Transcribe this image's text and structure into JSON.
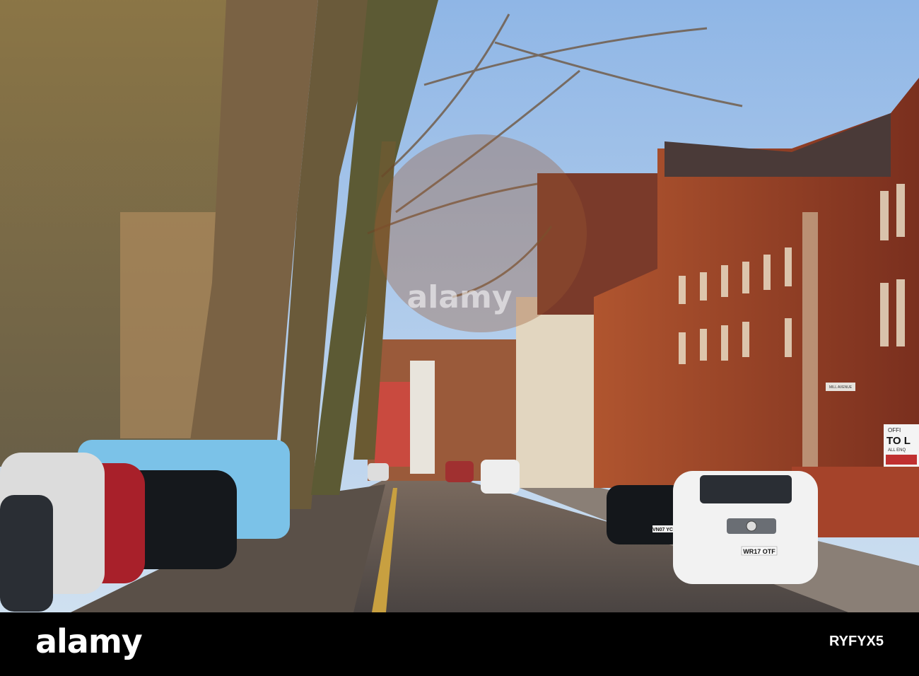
{
  "photo": {
    "description_colors": {
      "sky": "#a9c8ea",
      "brick": "#8e3a22",
      "cobble": "#5b5450",
      "shadow": "#2a2220"
    },
    "signs": {
      "street_sign": "MILL AVENUE",
      "letting_line1": "OFFI",
      "letting_line2": "TO L",
      "letting_line3": "ALL ENQ"
    },
    "plates": {
      "mercedes": "WR17 OTF",
      "black_car": "VN07 YCR"
    }
  },
  "watermark": "alamy",
  "footer": {
    "logo": "alamy",
    "image_id": "RYFYX5"
  }
}
